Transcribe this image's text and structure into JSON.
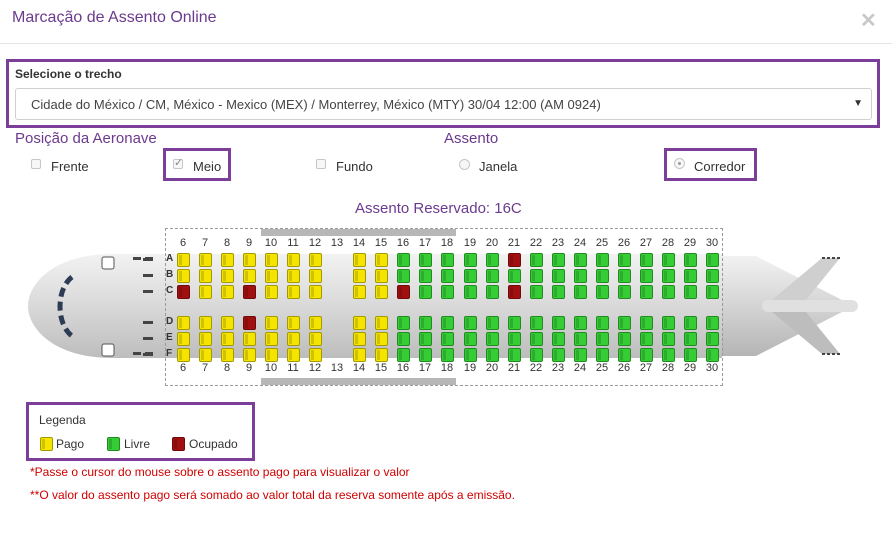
{
  "modal": {
    "title": "Marcação de Assento Online"
  },
  "trecho": {
    "label": "Selecione o trecho",
    "selected": "Cidade do México / CM, México - Mexico (MEX) / Monterrey, México (MTY) 30/04 12:00 (AM 0924)"
  },
  "posicao": {
    "title": "Posição da Aeronave",
    "options": [
      {
        "label": "Frente",
        "checked": false
      },
      {
        "label": "Meio",
        "checked": true
      },
      {
        "label": "Fundo",
        "checked": false
      }
    ]
  },
  "assento": {
    "title": "Assento",
    "options": [
      {
        "label": "Janela",
        "checked": false
      },
      {
        "label": "Corredor",
        "checked": true
      }
    ]
  },
  "reserved_text": "Assento Reservado: 16C",
  "seatmap": {
    "rows": [
      6,
      7,
      8,
      9,
      10,
      11,
      12,
      13,
      14,
      15,
      16,
      17,
      18,
      19,
      20,
      21,
      22,
      23,
      24,
      25,
      26,
      27,
      28,
      29,
      30
    ],
    "letters": [
      "A",
      "B",
      "C",
      "D",
      "E",
      "F"
    ],
    "seats": {
      "A": "PPPPPPP-PPLLLLLOLLLLLLLLL",
      "B": "PPPPPPP-PPLLLLLLLLLLLLLLL",
      "C": "OPPOPPP-PPOLLLLOLLLLLLLLL",
      "D": "PPPOPPP-PPLLLLLLLLLLLLLLL",
      "E": "PPPPPPP-PPLLLLLLLLLLLLLLL",
      "F": "PPPPPPP-PPLLLLLLLLLLLLLLL"
    },
    "status_colors": {
      "P": "#f4e400",
      "L": "#35cc35",
      "O": "#a11010"
    }
  },
  "legend": {
    "title": "Legenda",
    "items": [
      {
        "label": "Pago",
        "color": "#f4e400"
      },
      {
        "label": "Livre",
        "color": "#35cc35"
      },
      {
        "label": "Ocupado",
        "color": "#a11010"
      }
    ]
  },
  "notes": [
    "*Passe o cursor do mouse sobre o assento pago para visualizar o valor",
    "**O valor do assento pago será somado ao valor total da reserva somente após a emissão."
  ]
}
